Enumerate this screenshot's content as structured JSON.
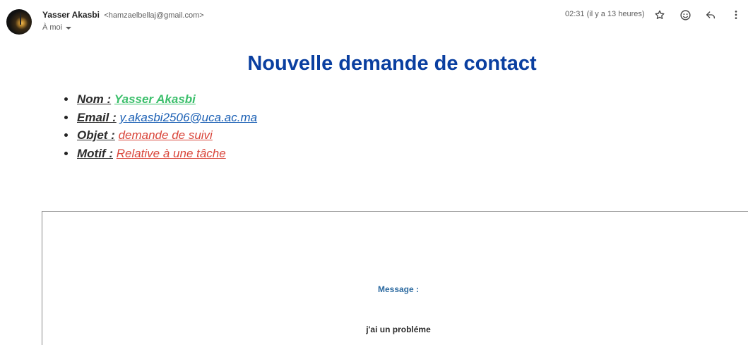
{
  "header": {
    "sender_name": "Yasser Akasbi",
    "sender_email": "<hamzaelbellaj@gmail.com>",
    "recipient": "À moi",
    "timestamp": "02:31 (il y a 13 heures)",
    "icons": [
      "star-icon",
      "emoji-icon",
      "reply-icon",
      "more-vert-icon"
    ]
  },
  "content": {
    "title": "Nouvelle demande de contact",
    "fields": [
      {
        "label": "Nom :",
        "value": "Yasser Akasbi"
      },
      {
        "label": "Email :",
        "value": "y.akasbi2506@uca.ac.ma"
      },
      {
        "label": "Objet :",
        "value": "demande de suivi"
      },
      {
        "label": "Motif :",
        "value": "Relative à une tâche"
      }
    ],
    "message_label": "Message :",
    "message_text": "j'ai un probléme"
  },
  "colors": {
    "title": "#0a3fa0",
    "name_value": "#3bbf6b",
    "email_value": "#1a5fb4",
    "other_values": "#d9453a",
    "message_label": "#2c6aa0"
  }
}
